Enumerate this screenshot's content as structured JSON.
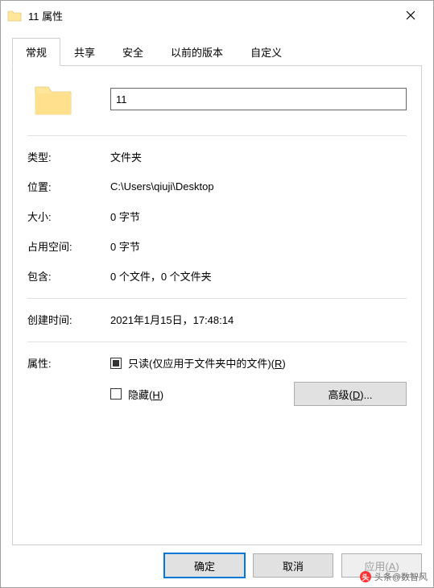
{
  "window": {
    "title": "11 属性"
  },
  "tabs": {
    "general": "常规",
    "sharing": "共享",
    "security": "安全",
    "previous": "以前的版本",
    "custom": "自定义"
  },
  "folder_name": "11",
  "fields": {
    "type_label": "类型:",
    "type_value": "文件夹",
    "location_label": "位置:",
    "location_value": "C:\\Users\\qiuji\\Desktop",
    "size_label": "大小:",
    "size_value": "0 字节",
    "sizeondisk_label": "占用空间:",
    "sizeondisk_value": "0 字节",
    "contains_label": "包含:",
    "contains_value": "0 个文件，0 个文件夹",
    "created_label": "创建时间:",
    "created_value": "2021年1月15日，17:48:14",
    "attributes_label": "属性:"
  },
  "attributes": {
    "readonly_text": "只读(仅应用于文件夹中的文件)(",
    "readonly_key": "R",
    "readonly_end": ")",
    "hidden_text": "隐藏(",
    "hidden_key": "H",
    "hidden_end": ")"
  },
  "buttons": {
    "advanced": "高级(",
    "advanced_key": "D",
    "advanced_end": ")...",
    "ok": "确定",
    "cancel": "取消",
    "apply": "应用(",
    "apply_key": "A",
    "apply_end": ")"
  },
  "watermark": "头条@数智风"
}
